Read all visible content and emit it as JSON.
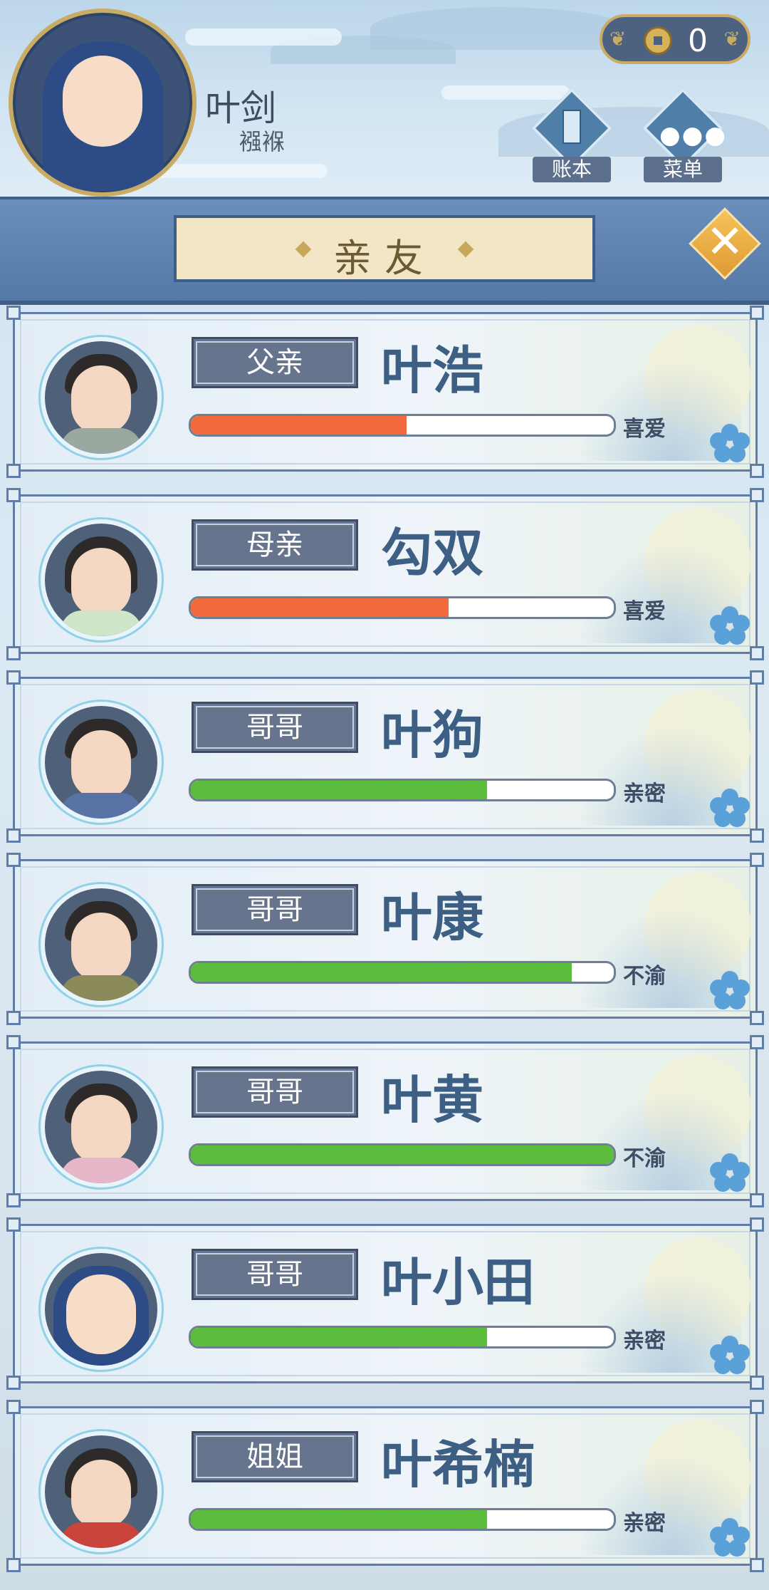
{
  "header": {
    "player_name": "叶剑",
    "player_title": "襁褓",
    "coins": "0",
    "account_label": "账本",
    "menu_label": "菜单"
  },
  "title": "亲友",
  "colors": {
    "orange_bar": "#f26a3b",
    "green_bar": "#5cbd3c",
    "relation_tag": "#66748d",
    "name_text": "#3e5f84"
  },
  "relatives": [
    {
      "relation": "父亲",
      "name": "叶浩",
      "status": "喜爱",
      "bar_color": "orange",
      "bar_fraction": 0.51
    },
    {
      "relation": "母亲",
      "name": "勾双",
      "status": "喜爱",
      "bar_color": "orange",
      "bar_fraction": 0.61
    },
    {
      "relation": "哥哥",
      "name": "叶狗",
      "status": "亲密",
      "bar_color": "green",
      "bar_fraction": 0.7
    },
    {
      "relation": "哥哥",
      "name": "叶康",
      "status": "不渝",
      "bar_color": "green",
      "bar_fraction": 0.9
    },
    {
      "relation": "哥哥",
      "name": "叶黄",
      "status": "不渝",
      "bar_color": "green",
      "bar_fraction": 1.0
    },
    {
      "relation": "哥哥",
      "name": "叶小田",
      "status": "亲密",
      "bar_color": "green",
      "bar_fraction": 0.7
    },
    {
      "relation": "姐姐",
      "name": "叶希楠",
      "status": "亲密",
      "bar_color": "green",
      "bar_fraction": 0.7
    }
  ]
}
